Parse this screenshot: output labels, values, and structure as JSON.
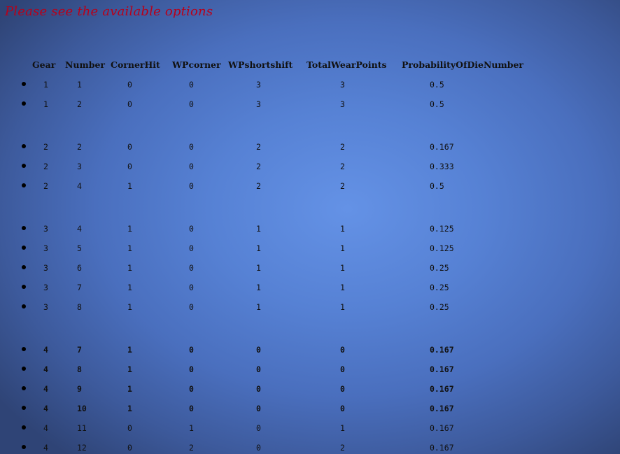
{
  "page": {
    "title": "Please see the available options"
  },
  "table": {
    "headers": [
      "Gear",
      "Number",
      "CornerHit",
      "WPcorner",
      "WPshortshift",
      "TotalWearPoints",
      "ProbabilityOfDieNumber"
    ],
    "groups": [
      {
        "rows": [
          {
            "cells": [
              "1",
              "1",
              "0",
              "0",
              "3",
              "3",
              "0.5"
            ],
            "bold": false
          },
          {
            "cells": [
              "1",
              "2",
              "0",
              "0",
              "3",
              "3",
              "0.5"
            ],
            "bold": false
          }
        ]
      },
      {
        "rows": [
          {
            "cells": [
              "2",
              "2",
              "0",
              "0",
              "2",
              "2",
              "0.167"
            ],
            "bold": false
          },
          {
            "cells": [
              "2",
              "3",
              "0",
              "0",
              "2",
              "2",
              "0.333"
            ],
            "bold": false
          },
          {
            "cells": [
              "2",
              "4",
              "1",
              "0",
              "2",
              "2",
              "0.5"
            ],
            "bold": false
          }
        ]
      },
      {
        "rows": [
          {
            "cells": [
              "3",
              "4",
              "1",
              "0",
              "1",
              "1",
              "0.125"
            ],
            "bold": false
          },
          {
            "cells": [
              "3",
              "5",
              "1",
              "0",
              "1",
              "1",
              "0.125"
            ],
            "bold": false
          },
          {
            "cells": [
              "3",
              "6",
              "1",
              "0",
              "1",
              "1",
              "0.25"
            ],
            "bold": false
          },
          {
            "cells": [
              "3",
              "7",
              "1",
              "0",
              "1",
              "1",
              "0.25"
            ],
            "bold": false
          },
          {
            "cells": [
              "3",
              "8",
              "1",
              "0",
              "1",
              "1",
              "0.25"
            ],
            "bold": false
          }
        ]
      },
      {
        "rows": [
          {
            "cells": [
              "4",
              "7",
              "1",
              "0",
              "0",
              "0",
              "0.167"
            ],
            "bold": true
          },
          {
            "cells": [
              "4",
              "8",
              "1",
              "0",
              "0",
              "0",
              "0.167"
            ],
            "bold": true
          },
          {
            "cells": [
              "4",
              "9",
              "1",
              "0",
              "0",
              "0",
              "0.167"
            ],
            "bold": true
          },
          {
            "cells": [
              "4",
              "10",
              "1",
              "0",
              "0",
              "0",
              "0.167"
            ],
            "bold": true
          },
          {
            "cells": [
              "4",
              "11",
              "0",
              "1",
              "0",
              "1",
              "0.167"
            ],
            "bold": false
          },
          {
            "cells": [
              "4",
              "12",
              "0",
              "2",
              "0",
              "2",
              "0.167"
            ],
            "bold": false
          }
        ]
      }
    ]
  }
}
